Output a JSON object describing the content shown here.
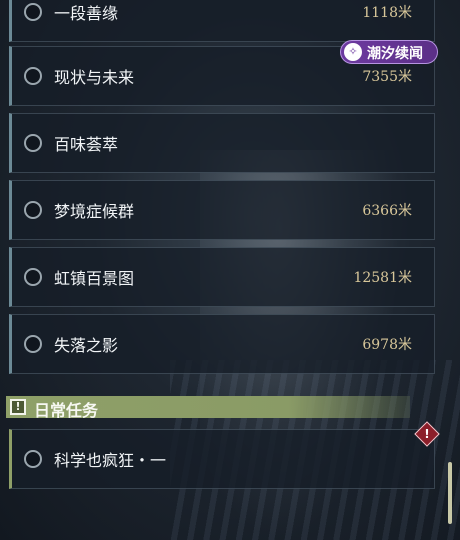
{
  "badge": {
    "text": "潮汐续闻",
    "icon": "tide-logo-icon"
  },
  "quests": [
    {
      "name": "一段善缘",
      "distance": "1118米"
    },
    {
      "name": "现状与未来",
      "distance": "7355米"
    },
    {
      "name": "百味荟萃",
      "distance": ""
    },
    {
      "name": "梦境症候群",
      "distance": "6366米"
    },
    {
      "name": "虹镇百景图",
      "distance": "12581米"
    },
    {
      "name": "失落之影",
      "distance": "6978米"
    }
  ],
  "daily_section": {
    "title": "日常任务",
    "icon": "exclamation-box-icon",
    "items": [
      {
        "name": "科学也疯狂・一",
        "distance": "",
        "alert_icon": "alert-diamond-icon"
      }
    ]
  },
  "colors": {
    "distance_text": "#d8c79a",
    "section_header_bg": "#8fa068",
    "badge_bg": "#6d3aa0",
    "alert": "#8c1f2a"
  }
}
